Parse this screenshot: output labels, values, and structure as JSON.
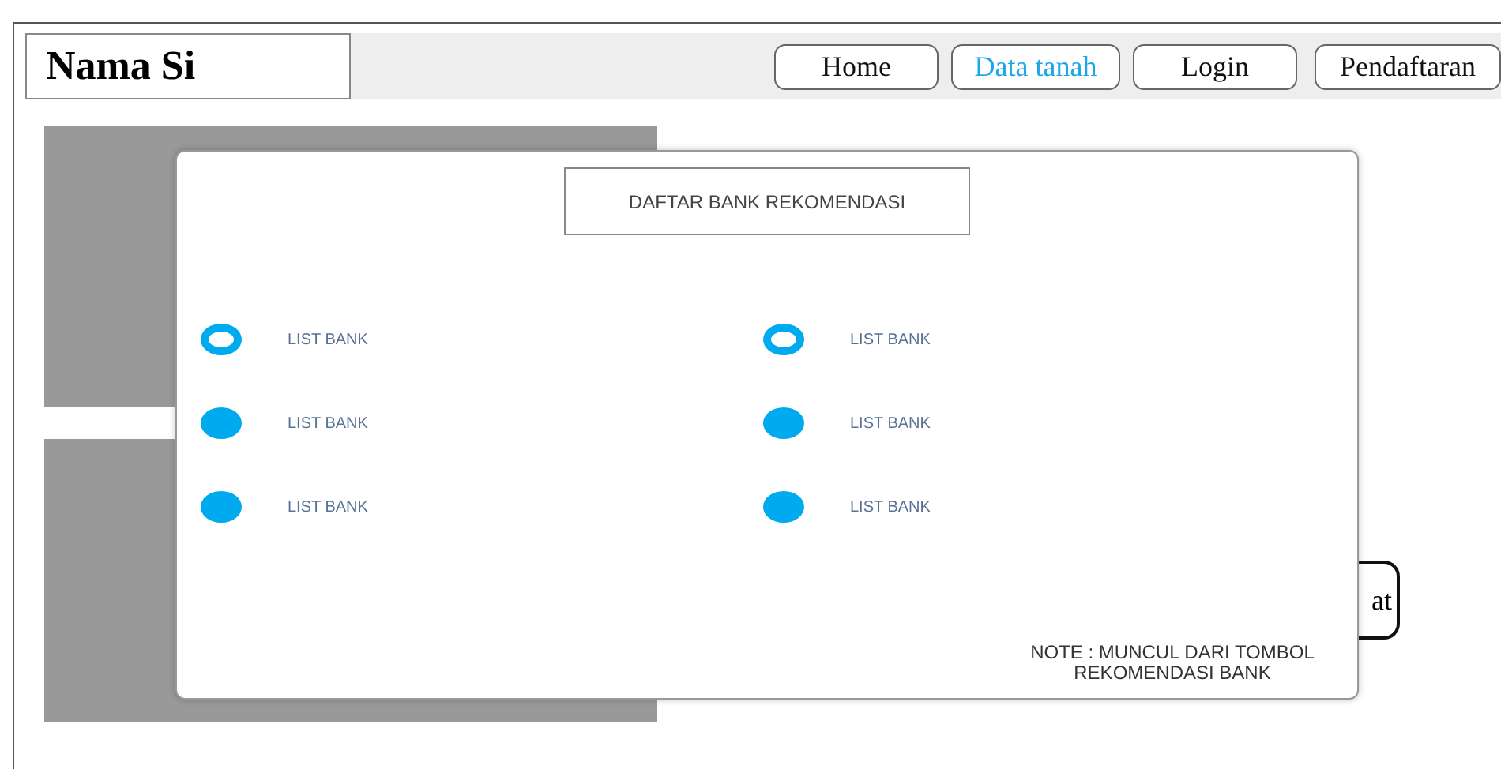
{
  "header": {
    "logo": "Nama Si",
    "nav": [
      {
        "label": "Home",
        "selected": false
      },
      {
        "label": "Data tanah",
        "selected": true
      },
      {
        "label": "Login",
        "selected": false
      },
      {
        "label": "Pendaftaran",
        "selected": false
      }
    ]
  },
  "background_button": {
    "label": "at"
  },
  "modal": {
    "title": "DAFTAR BANK REKOMENDASI",
    "options": [
      {
        "label": "LIST BANK",
        "selected": false
      },
      {
        "label": "LIST BANK",
        "selected": false
      },
      {
        "label": "LIST BANK",
        "selected": true
      },
      {
        "label": "LIST BANK",
        "selected": true
      },
      {
        "label": "LIST BANK",
        "selected": true
      },
      {
        "label": "LIST BANK",
        "selected": true
      }
    ],
    "note": "NOTE : MUNCUL DARI TOMBOL REKOMENDASI BANK"
  }
}
